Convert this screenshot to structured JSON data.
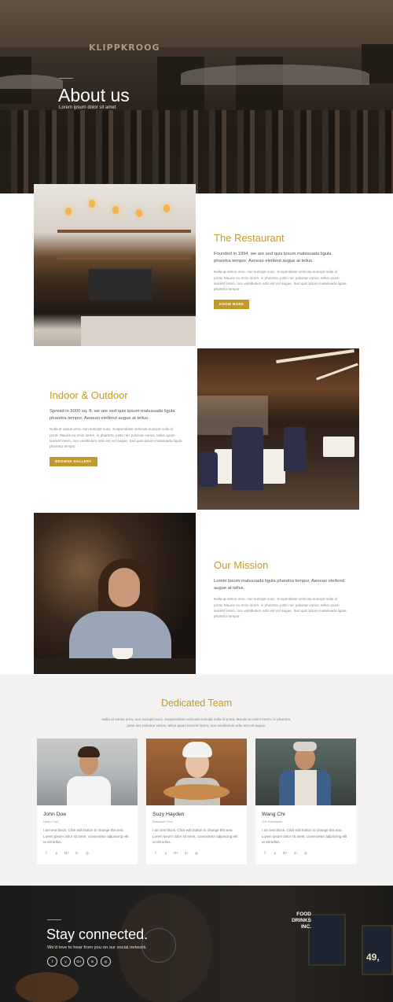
{
  "hero": {
    "sign": "KLIPPKROOG",
    "title": "About us",
    "subtitle": "Lorem ipsum dolor sit amet"
  },
  "sections": [
    {
      "title": "The Restaurant",
      "lead": "Founded in 1994, we are sed quis ipsum malesuada ligula pharetra tempor. Aenean eleifend augue at tellus.",
      "body": "Nulla at varius urna, non suscipit nunc. Suspendisse vehicula suscipit nulla id porta. Mauris eu enim lorem, in pharetra, justo nec pulvinar varius, tellus quam laoreet lorem, non vestibulum odio est vel augue. Sed quis ipsum malesuada ligula pharetra tempor.",
      "button": "KNOW MORE"
    },
    {
      "title": "Indoor & Outdoor",
      "lead": "Spread in 5000 sq. ft. we are sed quis ipsum malesuada ligula pharetra tempor. Aenean eleifend augue at tellus.",
      "body": "Nulla at varius urna, non suscipit nunc. Suspendisse vehicula suscipit nulla id porta. Mauris eu enim lorem, in pharetra, justo nec pulvinar varius, tellus quam laoreet lorem, non vestibulum odio est vel augue. Sed quis ipsum malesuada ligula pharetra tempor.",
      "button": "BROWSE GALLERY"
    },
    {
      "title": "Our Mission",
      "lead": "Lorem ipsum malesuada ligula pharetra tempor. Aenean eleifend augue at tellus.",
      "body": "Nulla at varius urna, non suscipit nunc. Suspendisse vehicula suscipit nulla id porta. Mauris eu enim lorem, in pharetra, justo nec pulvinar varius, tellus quam laoreet lorem, non vestibulum odio est vel augue. Sed quis ipsum malesuada ligula pharetra tempor."
    }
  ],
  "team": {
    "title": "Dedicated Team",
    "description": "Nulla at varius urna, non suscipit nunc. Suspendisse vehicula suscipit nulla id porta. Mauris eu enim lorem, in pharetra, justo nec pulvinar varius, tellus quam laoreet lorem, non vestibulum odio est vel augue.",
    "members": [
      {
        "name": "John Doe",
        "role": "Head Chef",
        "bio": "I am text block. Click edit button to change this text. Lorem ipsum dolor sit amet, consectetur adipiscing elit ut elit tellus."
      },
      {
        "name": "Suzy Hayden",
        "role": "Assistant Chef",
        "bio": "I am text block. Click edit button to change this text. Lorem ipsum dolor sit amet, consectetur adipiscing elit ut elit tellus."
      },
      {
        "name": "Wang Chi",
        "role": "The Barmaster",
        "bio": "I am text block. Click edit button to change this text. Lorem ipsum dolor sit amet, consectetur adipiscing elit ut elit tellus."
      }
    ],
    "social_icons": [
      "f",
      "y",
      "G+",
      "in",
      "◎"
    ]
  },
  "footer": {
    "title": "Stay connected.",
    "subtitle": "We'd love to hear from you on our social network.",
    "social_icons": [
      "f",
      "y",
      "G+",
      "in",
      "◎"
    ],
    "brand": "FOOD DRINKS INC.",
    "board_number": "49,"
  },
  "colors": {
    "accent": "#c19a2e",
    "team_bg": "#f3f2f0"
  }
}
